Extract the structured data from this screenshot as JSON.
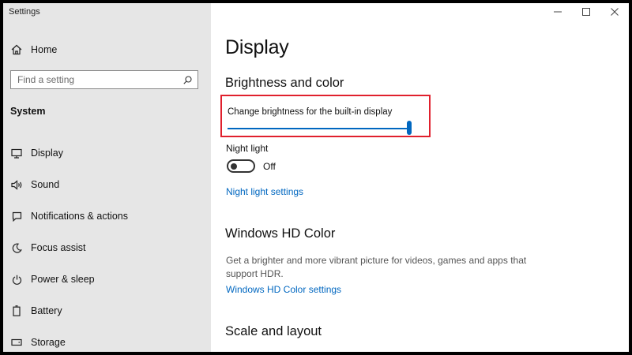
{
  "app": {
    "title": "Settings"
  },
  "colors": {
    "accent": "#0067c0",
    "highlight": "#e0202d",
    "sidebar_bg": "#e6e6e6"
  },
  "sidebar": {
    "home": {
      "label": "Home",
      "icon": "home-icon"
    },
    "search": {
      "placeholder": "Find a setting",
      "icon": "search-icon"
    },
    "section": "System",
    "items": [
      {
        "label": "Display",
        "icon": "monitor-icon"
      },
      {
        "label": "Sound",
        "icon": "speaker-icon"
      },
      {
        "label": "Notifications & actions",
        "icon": "notification-icon"
      },
      {
        "label": "Focus assist",
        "icon": "moon-icon"
      },
      {
        "label": "Power & sleep",
        "icon": "power-icon"
      },
      {
        "label": "Battery",
        "icon": "battery-icon"
      },
      {
        "label": "Storage",
        "icon": "storage-icon"
      }
    ]
  },
  "window_controls": [
    "minimize-icon",
    "maximize-icon",
    "close-icon"
  ],
  "main": {
    "title": "Display",
    "brightness_color": {
      "heading": "Brightness and color",
      "brightness_label": "Change brightness for the built-in display",
      "brightness_value": 100,
      "night_light_label": "Night light",
      "night_light_state": "Off",
      "night_light_link": "Night light settings"
    },
    "hd_color": {
      "heading": "Windows HD Color",
      "description": "Get a brighter and more vibrant picture for videos, games and apps that support HDR.",
      "link": "Windows HD Color settings"
    },
    "scale_layout": {
      "heading": "Scale and layout"
    }
  }
}
